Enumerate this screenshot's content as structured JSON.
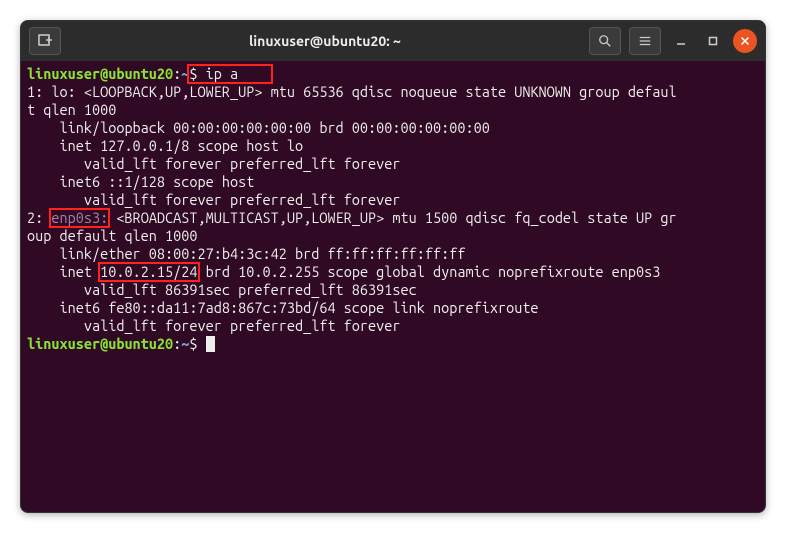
{
  "titlebar": {
    "title": "linuxuser@ubuntu20: ~"
  },
  "prompt": {
    "user_host": "linuxuser@ubuntu20",
    "separator": ":",
    "path": "~",
    "symbol": "$"
  },
  "command": "ip a",
  "output": {
    "line1a": "1: lo: <LOOPBACK,UP,LOWER_UP> mtu 65536 qdisc noqueue state UNKNOWN group defaul",
    "line1b": "t qlen 1000",
    "line2": "    link/loopback 00:00:00:00:00:00 brd 00:00:00:00:00:00",
    "line3": "    inet 127.0.0.1/8 scope host lo",
    "line4": "       valid_lft forever preferred_lft forever",
    "line5": "    inet6 ::1/128 scope host ",
    "line6": "       valid_lft forever preferred_lft forever",
    "line7_pre": "2: ",
    "line7_iface": "enp0s3:",
    "line7_post": " <BROADCAST,MULTICAST,UP,LOWER_UP> mtu 1500 qdisc fq_codel state UP gr",
    "line7b": "oup default qlen 1000",
    "line8": "    link/ether 08:00:27:b4:3c:42 brd ff:ff:ff:ff:ff:ff",
    "line9_pre": "    inet ",
    "line9_ip": "10.0.2.15/24",
    "line9_post": " brd 10.0.2.255 scope global dynamic noprefixroute enp0s3",
    "line10": "       valid_lft 86391sec preferred_lft 86391sec",
    "line11": "    inet6 fe80::da11:7ad8:867c:73bd/64 scope link noprefixroute ",
    "line12": "       valid_lft forever preferred_lft forever"
  }
}
